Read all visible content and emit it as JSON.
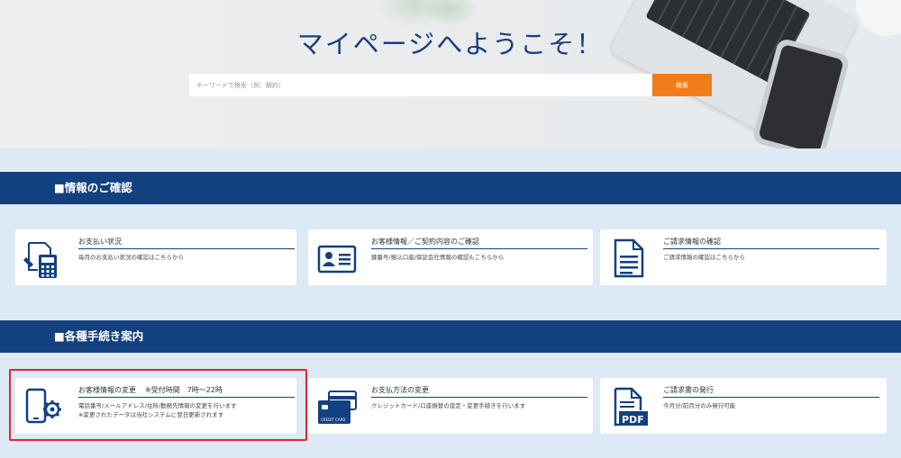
{
  "hero": {
    "title": "マイページへようこそ！",
    "search_placeholder": "キーワードで検索（例：解約）",
    "search_button": "検索"
  },
  "section1": {
    "title": "■情報のご確認",
    "cards": [
      {
        "title": "お支払い状況",
        "desc": "毎月のお支払い状況の確認はこちらから",
        "icon": "calculator-document-icon"
      },
      {
        "title": "お客様情報／ご契約内容のご確認",
        "desc": "鍵番号/振込口座/保証会社情報の確認もこちらから",
        "icon": "id-card-icon"
      },
      {
        "title": "ご請求情報の確認",
        "desc": "ご請求情報の確認はこちらから",
        "icon": "document-icon"
      }
    ]
  },
  "section2": {
    "title": "■各種手続き案内",
    "cards": [
      {
        "title": "お客様情報の変更",
        "note": "※受付時間　7時～22時",
        "desc1": "電話番号/メールアドレス/住所/勤務先情報の変更を行います",
        "desc2": "※変更されたデータは当社システムに翌日更新されます",
        "icon": "smartphone-settings-icon"
      },
      {
        "title": "お支払方法の変更",
        "desc1": "クレジットカード/口座振替の設定・変更手続きを行います",
        "icon": "credit-card-icon",
        "card_label": "CREDIT CARD"
      },
      {
        "title": "ご請求書の発行",
        "desc1": "今月分/前月分のみ発行可能",
        "icon": "pdf-document-icon",
        "pdf_label": "PDF"
      }
    ]
  },
  "colors": {
    "brand": "#13407e",
    "accent": "#f07d18",
    "highlight": "#e0282e"
  }
}
